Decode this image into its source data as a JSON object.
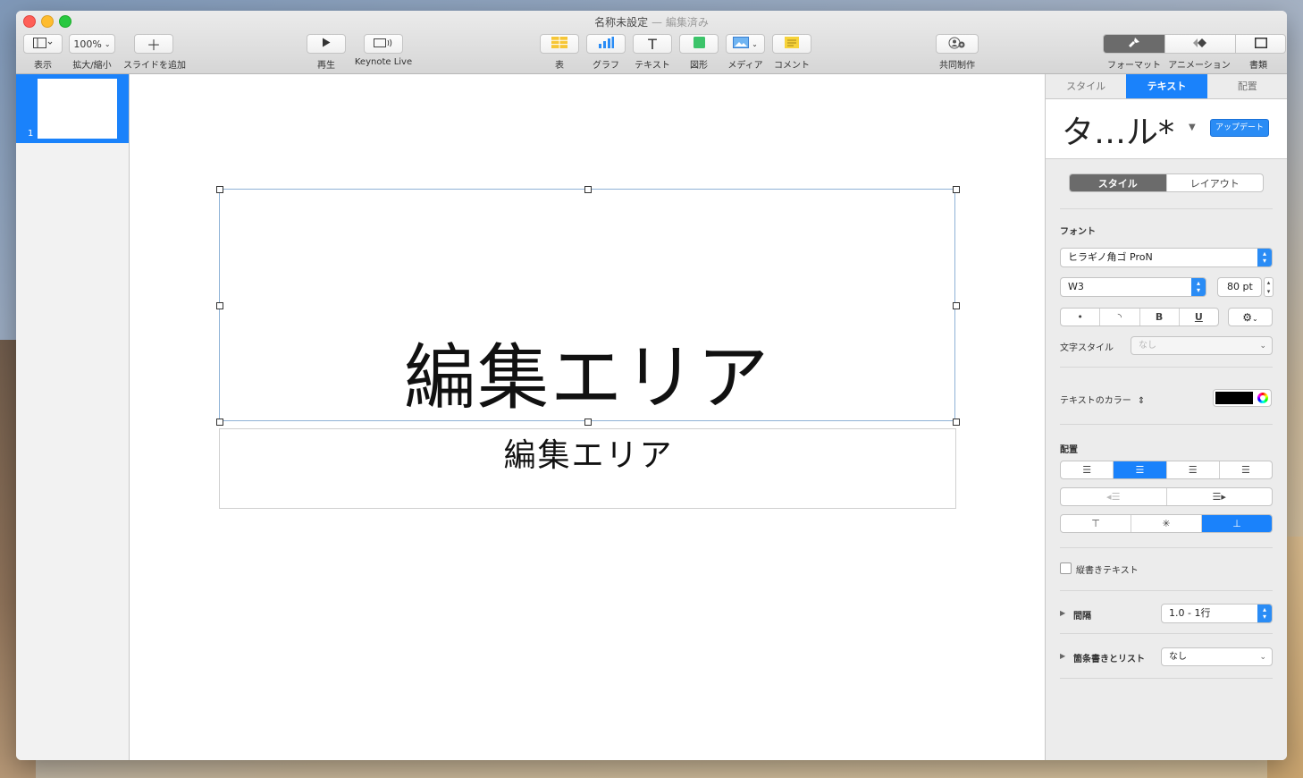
{
  "window": {
    "title": "名称未設定",
    "title_status": "— 編集済み"
  },
  "toolbar": {
    "view_label": "表示",
    "zoom_value": "100%",
    "zoom_label": "拡大/縮小",
    "add_slide_label": "スライドを追加",
    "play_label": "再生",
    "keynote_live_label": "Keynote Live",
    "table_label": "表",
    "chart_label": "グラフ",
    "text_label": "テキスト",
    "shape_label": "図形",
    "media_label": "メディア",
    "comment_label": "コメント",
    "collab_label": "共同制作",
    "format_label": "フォーマット",
    "animation_label": "アニメーション",
    "document_label": "書類"
  },
  "navigator": {
    "slides": [
      {
        "number": "1"
      }
    ]
  },
  "slide": {
    "title": "編集エリア",
    "subtitle": "編集エリア"
  },
  "inspector": {
    "tabs": [
      "スタイル",
      "テキスト",
      "配置"
    ],
    "active_tab": "テキスト",
    "paragraph_style": "タ…ル*",
    "update_button": "アップデート",
    "subtabs": [
      "スタイル",
      "レイアウト"
    ],
    "font_section": "フォント",
    "font_family": "ヒラギノ角ゴ ProN",
    "font_weight": "W3",
    "font_size": "80 pt",
    "format_buttons": [
      "•",
      "◝",
      "B",
      "U"
    ],
    "char_style_label": "文字スタイル",
    "char_style_value": "なし",
    "text_color_label": "テキストのカラー",
    "text_color": "#000000",
    "alignment_section": "配置",
    "vertical_text_label": "縦書きテキスト",
    "spacing_label": "間隔",
    "spacing_value": "1.0 - 1行",
    "bullets_label": "箇条書きとリスト",
    "bullets_value": "なし"
  },
  "colors": {
    "accent": "#1a82fb",
    "selection": "#1a82fb"
  }
}
